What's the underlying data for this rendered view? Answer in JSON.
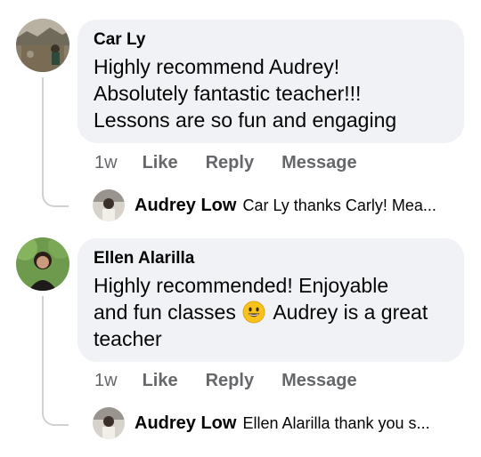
{
  "comments": [
    {
      "author": "Car Ly",
      "lines": [
        "Highly recommend Audrey!",
        "Absolutely fantastic teacher!!!",
        "Lessons are so fun and engaging"
      ],
      "time": "1w",
      "actions": {
        "like": "Like",
        "reply": "Reply",
        "message": "Message"
      },
      "reply": {
        "author": "Audrey Low",
        "text": "Car Ly thanks Carly! Mea..."
      }
    },
    {
      "author": "Ellen Alarilla",
      "lines": [
        "Highly recommended!  Enjoyable",
        "and fun classes",
        "Audrey is a great",
        "teacher"
      ],
      "time": "1w",
      "actions": {
        "like": "Like",
        "reply": "Reply",
        "message": "Message"
      },
      "reply": {
        "author": "Audrey Low",
        "text": "Ellen Alarilla thank you s..."
      }
    }
  ],
  "icons": {
    "emoji": "grinning-face-emoji",
    "avatar": "profile-photo"
  }
}
